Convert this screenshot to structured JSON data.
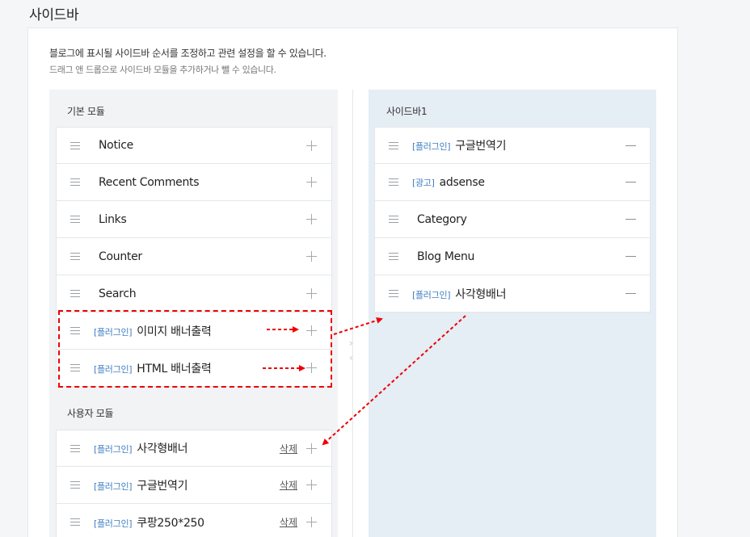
{
  "page": {
    "title": "사이드바"
  },
  "description": {
    "line1": "블로그에 표시될 사이드바 순서를 조정하고 관련 설정을 할 수 있습니다.",
    "line2": "드래그 앤 드롭으로 사이드바 모듈을 추가하거나 뺄 수 있습니다."
  },
  "basic_modules": {
    "heading": "기본 모듈",
    "items": [
      {
        "tag": "",
        "label": "Notice"
      },
      {
        "tag": "",
        "label": "Recent Comments"
      },
      {
        "tag": "",
        "label": "Links"
      },
      {
        "tag": "",
        "label": "Counter"
      },
      {
        "tag": "",
        "label": "Search"
      },
      {
        "tag": "[플러그인]",
        "label": "이미지 배너출력"
      },
      {
        "tag": "[플러그인]",
        "label": "HTML 배너출력"
      }
    ]
  },
  "user_modules": {
    "heading": "사용자 모듈",
    "delete_label": "삭제",
    "items": [
      {
        "tag": "[플러그인]",
        "label": "사각형배너"
      },
      {
        "tag": "[플러그인]",
        "label": "구글번역기"
      },
      {
        "tag": "[플러그인]",
        "label": "쿠팡250*250"
      }
    ]
  },
  "sidebar1": {
    "heading": "사이드바1",
    "items": [
      {
        "tag": "[플러그인]",
        "label": "구글번역기"
      },
      {
        "tag": "[광고]",
        "label": "adsense"
      },
      {
        "tag": "",
        "label": "Category"
      },
      {
        "tag": "",
        "label": "Blog Menu"
      },
      {
        "tag": "[플러그인]",
        "label": "사각형배너"
      }
    ]
  },
  "colors": {
    "tag": "#3f7ec2",
    "annotation": "#e00000",
    "right_panel": "#e5edf5"
  },
  "icons": {
    "handle": "drag-handle-icon",
    "add": "plus-icon",
    "remove": "minus-icon"
  }
}
